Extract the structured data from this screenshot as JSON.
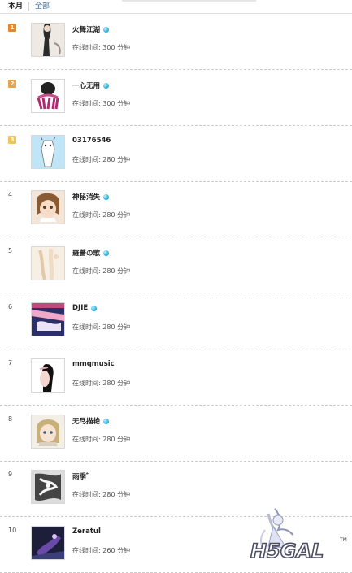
{
  "tabs": {
    "month": "本月",
    "all": "全部"
  },
  "badge_icon": "verified-icon",
  "rows": [
    {
      "rank": "1",
      "medal": "gold",
      "username": "火舞江湖",
      "badge": true,
      "online_label": "在线时间: ",
      "minutes": "300",
      "unit": " 分钟"
    },
    {
      "rank": "2",
      "medal": "silver",
      "username": "一心无用",
      "badge": true,
      "online_label": "在线时间: ",
      "minutes": "300",
      "unit": " 分钟"
    },
    {
      "rank": "3",
      "medal": "bronze",
      "username": "03176546",
      "badge": false,
      "online_label": "在线时间: ",
      "minutes": "280",
      "unit": " 分钟"
    },
    {
      "rank": "4",
      "medal": "",
      "username": "神秘消失",
      "badge": true,
      "online_label": "在线时间: ",
      "minutes": "280",
      "unit": " 分钟"
    },
    {
      "rank": "5",
      "medal": "",
      "username": "羅薔の歌",
      "badge": true,
      "online_label": "在线时间: ",
      "minutes": "280",
      "unit": " 分钟"
    },
    {
      "rank": "6",
      "medal": "",
      "username": "DJIE",
      "badge": true,
      "online_label": "在线时间: ",
      "minutes": "280",
      "unit": " 分钟"
    },
    {
      "rank": "7",
      "medal": "",
      "username": "mmqmusic",
      "badge": false,
      "online_label": "在线时间: ",
      "minutes": "280",
      "unit": " 分钟"
    },
    {
      "rank": "8",
      "medal": "",
      "username": "无尽描艳",
      "badge": true,
      "online_label": "在线时间: ",
      "minutes": "280",
      "unit": " 分钟"
    },
    {
      "rank": "9",
      "medal": "",
      "username": "雨季゛",
      "badge": false,
      "online_label": "在线时间: ",
      "minutes": "280",
      "unit": " 分钟"
    },
    {
      "rank": "10",
      "medal": "",
      "username": "Zeratul",
      "badge": false,
      "online_label": "在线时间: ",
      "minutes": "260",
      "unit": " 分钟"
    }
  ],
  "watermark": {
    "logo_text": "H5GAL",
    "tm": "TM"
  },
  "colors": {
    "accent_link": "#336699",
    "badge_blue": "#3ab9e6",
    "medal_gold": "#e8872a",
    "medal_silver": "#e8a44a",
    "medal_bronze": "#f0c45c"
  }
}
